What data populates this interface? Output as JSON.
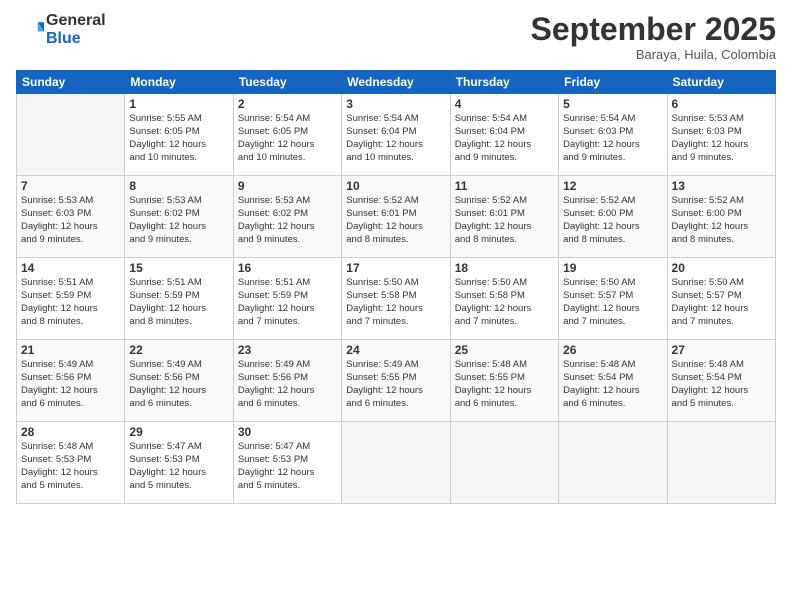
{
  "header": {
    "logo_general": "General",
    "logo_blue": "Blue",
    "month_title": "September 2025",
    "location": "Baraya, Huila, Colombia"
  },
  "weekdays": [
    "Sunday",
    "Monday",
    "Tuesday",
    "Wednesday",
    "Thursday",
    "Friday",
    "Saturday"
  ],
  "weeks": [
    [
      {
        "day": "",
        "sunrise": "",
        "sunset": "",
        "daylight": ""
      },
      {
        "day": "1",
        "sunrise": "Sunrise: 5:55 AM",
        "sunset": "Sunset: 6:05 PM",
        "daylight": "Daylight: 12 hours and 10 minutes."
      },
      {
        "day": "2",
        "sunrise": "Sunrise: 5:54 AM",
        "sunset": "Sunset: 6:05 PM",
        "daylight": "Daylight: 12 hours and 10 minutes."
      },
      {
        "day": "3",
        "sunrise": "Sunrise: 5:54 AM",
        "sunset": "Sunset: 6:04 PM",
        "daylight": "Daylight: 12 hours and 10 minutes."
      },
      {
        "day": "4",
        "sunrise": "Sunrise: 5:54 AM",
        "sunset": "Sunset: 6:04 PM",
        "daylight": "Daylight: 12 hours and 9 minutes."
      },
      {
        "day": "5",
        "sunrise": "Sunrise: 5:54 AM",
        "sunset": "Sunset: 6:03 PM",
        "daylight": "Daylight: 12 hours and 9 minutes."
      },
      {
        "day": "6",
        "sunrise": "Sunrise: 5:53 AM",
        "sunset": "Sunset: 6:03 PM",
        "daylight": "Daylight: 12 hours and 9 minutes."
      }
    ],
    [
      {
        "day": "7",
        "sunrise": "Sunrise: 5:53 AM",
        "sunset": "Sunset: 6:03 PM",
        "daylight": "Daylight: 12 hours and 9 minutes."
      },
      {
        "day": "8",
        "sunrise": "Sunrise: 5:53 AM",
        "sunset": "Sunset: 6:02 PM",
        "daylight": "Daylight: 12 hours and 9 minutes."
      },
      {
        "day": "9",
        "sunrise": "Sunrise: 5:53 AM",
        "sunset": "Sunset: 6:02 PM",
        "daylight": "Daylight: 12 hours and 9 minutes."
      },
      {
        "day": "10",
        "sunrise": "Sunrise: 5:52 AM",
        "sunset": "Sunset: 6:01 PM",
        "daylight": "Daylight: 12 hours and 8 minutes."
      },
      {
        "day": "11",
        "sunrise": "Sunrise: 5:52 AM",
        "sunset": "Sunset: 6:01 PM",
        "daylight": "Daylight: 12 hours and 8 minutes."
      },
      {
        "day": "12",
        "sunrise": "Sunrise: 5:52 AM",
        "sunset": "Sunset: 6:00 PM",
        "daylight": "Daylight: 12 hours and 8 minutes."
      },
      {
        "day": "13",
        "sunrise": "Sunrise: 5:52 AM",
        "sunset": "Sunset: 6:00 PM",
        "daylight": "Daylight: 12 hours and 8 minutes."
      }
    ],
    [
      {
        "day": "14",
        "sunrise": "Sunrise: 5:51 AM",
        "sunset": "Sunset: 5:59 PM",
        "daylight": "Daylight: 12 hours and 8 minutes."
      },
      {
        "day": "15",
        "sunrise": "Sunrise: 5:51 AM",
        "sunset": "Sunset: 5:59 PM",
        "daylight": "Daylight: 12 hours and 8 minutes."
      },
      {
        "day": "16",
        "sunrise": "Sunrise: 5:51 AM",
        "sunset": "Sunset: 5:59 PM",
        "daylight": "Daylight: 12 hours and 7 minutes."
      },
      {
        "day": "17",
        "sunrise": "Sunrise: 5:50 AM",
        "sunset": "Sunset: 5:58 PM",
        "daylight": "Daylight: 12 hours and 7 minutes."
      },
      {
        "day": "18",
        "sunrise": "Sunrise: 5:50 AM",
        "sunset": "Sunset: 5:58 PM",
        "daylight": "Daylight: 12 hours and 7 minutes."
      },
      {
        "day": "19",
        "sunrise": "Sunrise: 5:50 AM",
        "sunset": "Sunset: 5:57 PM",
        "daylight": "Daylight: 12 hours and 7 minutes."
      },
      {
        "day": "20",
        "sunrise": "Sunrise: 5:50 AM",
        "sunset": "Sunset: 5:57 PM",
        "daylight": "Daylight: 12 hours and 7 minutes."
      }
    ],
    [
      {
        "day": "21",
        "sunrise": "Sunrise: 5:49 AM",
        "sunset": "Sunset: 5:56 PM",
        "daylight": "Daylight: 12 hours and 6 minutes."
      },
      {
        "day": "22",
        "sunrise": "Sunrise: 5:49 AM",
        "sunset": "Sunset: 5:56 PM",
        "daylight": "Daylight: 12 hours and 6 minutes."
      },
      {
        "day": "23",
        "sunrise": "Sunrise: 5:49 AM",
        "sunset": "Sunset: 5:56 PM",
        "daylight": "Daylight: 12 hours and 6 minutes."
      },
      {
        "day": "24",
        "sunrise": "Sunrise: 5:49 AM",
        "sunset": "Sunset: 5:55 PM",
        "daylight": "Daylight: 12 hours and 6 minutes."
      },
      {
        "day": "25",
        "sunrise": "Sunrise: 5:48 AM",
        "sunset": "Sunset: 5:55 PM",
        "daylight": "Daylight: 12 hours and 6 minutes."
      },
      {
        "day": "26",
        "sunrise": "Sunrise: 5:48 AM",
        "sunset": "Sunset: 5:54 PM",
        "daylight": "Daylight: 12 hours and 6 minutes."
      },
      {
        "day": "27",
        "sunrise": "Sunrise: 5:48 AM",
        "sunset": "Sunset: 5:54 PM",
        "daylight": "Daylight: 12 hours and 5 minutes."
      }
    ],
    [
      {
        "day": "28",
        "sunrise": "Sunrise: 5:48 AM",
        "sunset": "Sunset: 5:53 PM",
        "daylight": "Daylight: 12 hours and 5 minutes."
      },
      {
        "day": "29",
        "sunrise": "Sunrise: 5:47 AM",
        "sunset": "Sunset: 5:53 PM",
        "daylight": "Daylight: 12 hours and 5 minutes."
      },
      {
        "day": "30",
        "sunrise": "Sunrise: 5:47 AM",
        "sunset": "Sunset: 5:53 PM",
        "daylight": "Daylight: 12 hours and 5 minutes."
      },
      {
        "day": "",
        "sunrise": "",
        "sunset": "",
        "daylight": ""
      },
      {
        "day": "",
        "sunrise": "",
        "sunset": "",
        "daylight": ""
      },
      {
        "day": "",
        "sunrise": "",
        "sunset": "",
        "daylight": ""
      },
      {
        "day": "",
        "sunrise": "",
        "sunset": "",
        "daylight": ""
      }
    ]
  ]
}
